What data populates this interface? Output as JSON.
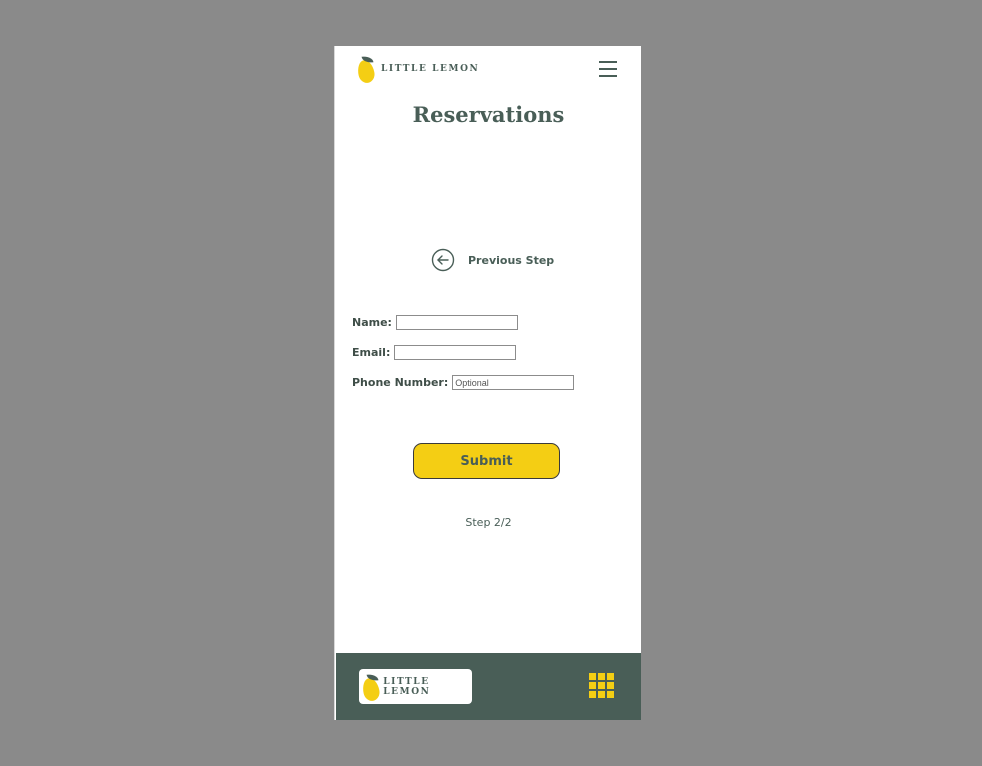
{
  "brand": {
    "name": "LITTLE LEMON",
    "primary_color": "#495e57",
    "accent_color": "#f4ce14"
  },
  "header": {
    "logo_text": "LITTLE LEMON",
    "menu_icon": "hamburger-menu-icon"
  },
  "page": {
    "title": "Reservations"
  },
  "navigation": {
    "previous_step_label": "Previous Step",
    "previous_step_icon": "arrow-left-circle-icon"
  },
  "form": {
    "name": {
      "label": "Name:",
      "value": "",
      "placeholder": ""
    },
    "email": {
      "label": "Email:",
      "value": "",
      "placeholder": ""
    },
    "phone": {
      "label": "Phone Number:",
      "value": "",
      "placeholder": "Optional"
    },
    "submit_label": "Submit"
  },
  "progress": {
    "step_text": "Step 2/2"
  },
  "footer": {
    "logo_text": "LITTLE LEMON",
    "grid_icon": "grid-menu-icon"
  }
}
